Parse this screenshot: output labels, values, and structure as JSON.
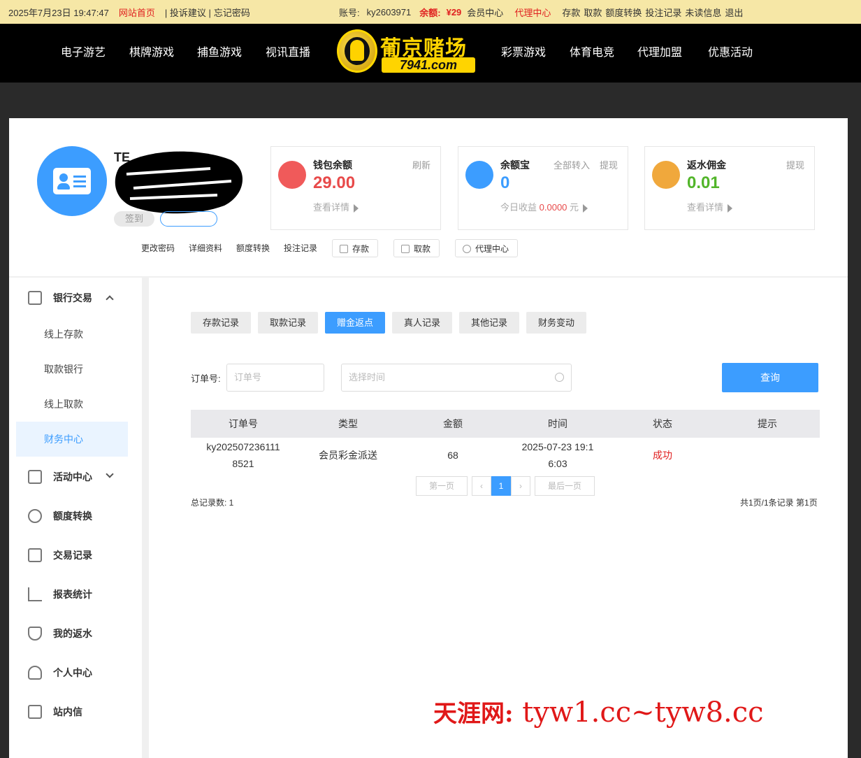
{
  "topbar": {
    "datetime": "2025年7月23日  19:47:47",
    "home": "网站首页",
    "complaint": "| 投诉建议 |",
    "forgot": "忘记密码",
    "account_label": "账号:",
    "account": "ky2603971",
    "balance_label": "余额:",
    "balance": "¥29",
    "member_center": "会员中心",
    "agent_center": "代理中心",
    "deposit": "存款",
    "withdraw": "取款",
    "transfer": "额度转换",
    "bet_records": "投注记录",
    "unread": "未读信息",
    "logout": "退出"
  },
  "nav": {
    "left": [
      "电子游艺",
      "棋牌游戏",
      "捕鱼游戏",
      "视讯直播"
    ],
    "right": [
      "彩票游戏",
      "体育电竞",
      "代理加盟",
      "优惠活动"
    ],
    "logo_text": "葡京赌场",
    "logo_sub": "7941.com"
  },
  "profile": {
    "name": "TE",
    "signin": "签到",
    "links": [
      "更改密码",
      "详细资料",
      "额度转换",
      "投注记录"
    ],
    "buttons": [
      "存款",
      "取款",
      "代理中心"
    ]
  },
  "cards": [
    {
      "title": "钱包余额",
      "action": "刷新",
      "value": "29.00",
      "sub": "查看详情",
      "color": "#e84a4a"
    },
    {
      "title": "余额宝",
      "action1": "全部转入",
      "action2": "提现",
      "value": "0",
      "sub_prefix": "今日收益",
      "sub_value": "0.0000",
      "sub_unit": "元",
      "color": "#3c9dff"
    },
    {
      "title": "返水佣金",
      "action": "提现",
      "value": "0.01",
      "sub": "查看详情",
      "color": "#52b52a"
    }
  ],
  "sidebar": {
    "bank": "银行交易",
    "sub": [
      "线上存款",
      "取款银行",
      "线上取款",
      "财务中心"
    ],
    "items": [
      "活动中心",
      "额度转换",
      "交易记录",
      "报表统计",
      "我的返水",
      "个人中心",
      "站内信"
    ]
  },
  "tabs": [
    "存款记录",
    "取款记录",
    "赠金返点",
    "真人记录",
    "其他记录",
    "财务变动"
  ],
  "filter": {
    "order_label": "订单号:",
    "order_placeholder": "订单号",
    "time_placeholder": "选择时间",
    "query": "查询"
  },
  "table": {
    "headers": [
      "订单号",
      "类型",
      "金额",
      "时间",
      "状态",
      "提示"
    ],
    "rows": [
      {
        "order_1": "ky202507236111",
        "order_2": "8521",
        "type": "会员彩金派送",
        "amount": "68",
        "time_1": "2025-07-23 19:1",
        "time_2": "6:03",
        "status": "成功",
        "tip": ""
      }
    ]
  },
  "pagination": {
    "first": "第一页",
    "prev": "‹",
    "current": "1",
    "next": "›",
    "last": "最后一页",
    "total_records": "总记录数: 1",
    "summary": "共1页/1条记录 第1页"
  },
  "watermark": {
    "brand": "天涯网:",
    "domains": "tyw1.cc~tyw8.cc"
  }
}
